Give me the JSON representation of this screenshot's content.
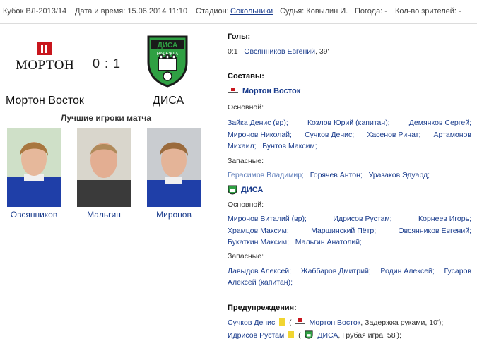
{
  "header": {
    "tournament": "Кубок ВЛ-2013/14",
    "datetime": "Дата и время: 15.06.2014 11:10",
    "stadium_label": "Стадион:",
    "stadium": "Сокольники",
    "referee": "Судья: Ковылин И.",
    "weather": "Погода: -",
    "spectators": "Кол-во зрителей: -"
  },
  "match": {
    "home": {
      "name": "Мортон Восток",
      "logo_text": "МОРТОН"
    },
    "away": {
      "name": "ДИСА",
      "logo_text": "ДИСА",
      "logo_subtext": "НАДЕЖДА"
    },
    "score": "0 : 1",
    "best_players_title": "Лучшие игроки матча",
    "best_players": [
      {
        "name": "Овсянников",
        "shirt_color": "#1f3fa8"
      },
      {
        "name": "Мальгин",
        "shirt_color": "#3a3a3a"
      },
      {
        "name": "Миронов",
        "shirt_color": "#1f3fa8"
      }
    ]
  },
  "goals": {
    "title": "Голы:",
    "items": [
      {
        "score": "0:1",
        "player": "Овсянников Евгений",
        "minute": ", 39'"
      }
    ]
  },
  "lineups": {
    "title": "Составы:",
    "home": {
      "team": "Мортон Восток",
      "main_label": "Основной:",
      "main": [
        [
          "Зайка Денис (вр);",
          "Козлов Юрий (капитан);",
          "Демянков Сергей;"
        ],
        [
          "Миронов Николай;",
          "Сучков Денис;",
          "Хасенов Ринат;",
          "Артамонов"
        ],
        [
          "Михаил;",
          "Бунтов Максим;"
        ]
      ],
      "subs_label": "Запасные:",
      "subs": [
        [
          "Герасимов Владимир;",
          "Горячев Антон;",
          "Уразаков Эдуард;"
        ]
      ]
    },
    "away": {
      "team": "ДИСА",
      "main_label": "Основной:",
      "main": [
        [
          "Миронов Виталий (вр);",
          "Идрисов Рустам;",
          "Корнеев Игорь;"
        ],
        [
          "Храмцов Максим;",
          "Маршинский Пётр;",
          "Овсянников Евгений;"
        ],
        [
          "Букаткин Максим;",
          "Мальгин Анатолий;"
        ]
      ],
      "subs_label": "Запасные:",
      "subs": [
        [
          "Давыдов Алексей;",
          "Жаббаров Дмитрий;",
          "Родин Алексей;",
          "Гусаров"
        ],
        [
          "Алексей (капитан);"
        ]
      ]
    }
  },
  "warnings": {
    "title": "Предупреждения:",
    "items": [
      {
        "player": "Сучков Денис",
        "open": "(",
        "team": "Мортон Восток",
        "reason": ", Задержка руками, 10');"
      },
      {
        "player": "Идрисов Рустам",
        "open": "(",
        "team": "ДИСА",
        "reason": ", Грубая игра, 58');"
      }
    ]
  },
  "colors": {
    "link": "#1a3c8c",
    "brand_red": "#c8161d",
    "disa_green": "#2fa043",
    "yellow_card": "#f1d531"
  }
}
